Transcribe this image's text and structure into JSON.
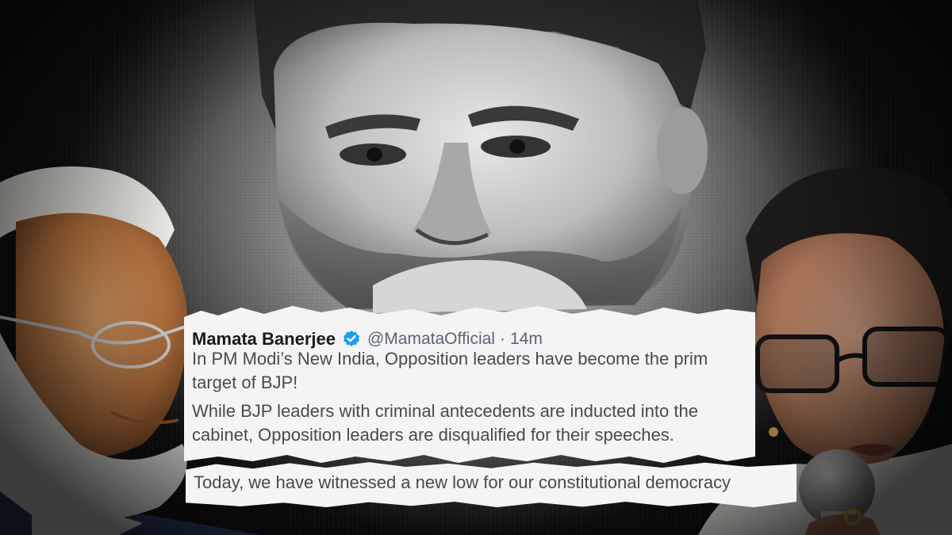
{
  "tweet": {
    "author_name": "Mamata Banerjee",
    "verified_icon": "verified-badge-icon",
    "verified_color": "#1d9bf0",
    "handle": "@MamataOfficial",
    "separator": "·",
    "time": "14m",
    "lines": [
      "In PM Modi’s New India, Opposition leaders have become the prim",
      "target of BJP!",
      "While BJP leaders with criminal antecedents are inducted into the",
      "cabinet, Opposition leaders are disqualified for their speeches.",
      "Today, we have witnessed a new low for our constitutional democracy"
    ]
  },
  "colors": {
    "strip_background": "#f4f4f4",
    "text": "#4a4a4a",
    "name": "#1a1a1a",
    "meta": "#5b6470"
  }
}
